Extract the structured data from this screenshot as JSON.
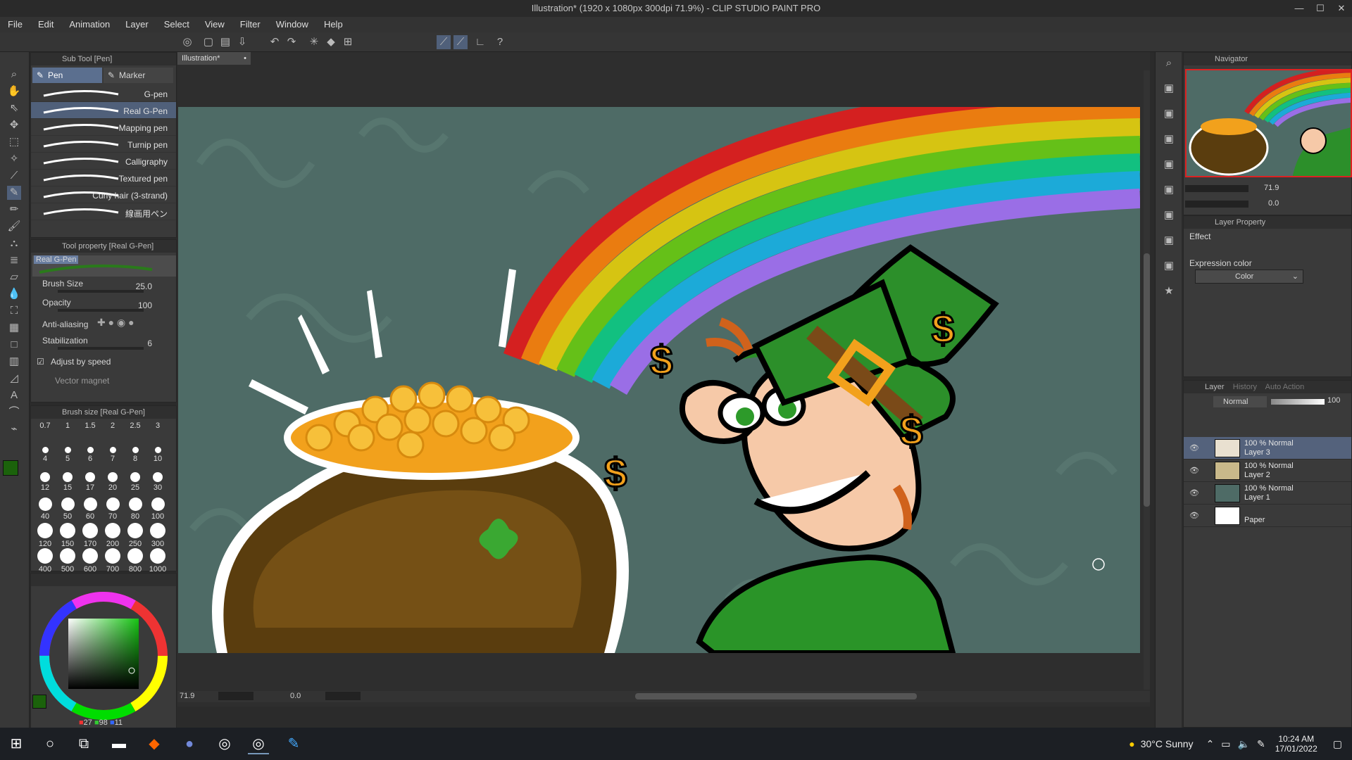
{
  "window": {
    "title": "Illustration* (1920 x 1080px 300dpi 71.9%) - CLIP STUDIO PAINT PRO",
    "controls": [
      "—",
      "☐",
      "✕"
    ]
  },
  "menu": [
    "File",
    "Edit",
    "Animation",
    "Layer",
    "Select",
    "View",
    "Filter",
    "Window",
    "Help"
  ],
  "subtool_panel": {
    "header": "Sub Tool [Pen]",
    "tabs": [
      "Pen",
      "Marker"
    ],
    "brushes": [
      "G-pen",
      "Real G-Pen",
      "Mapping pen",
      "Turnip pen",
      "Calligraphy",
      "Textured pen",
      "Curly hair (3-strand)",
      "線画用ペン"
    ],
    "selected_index": 1
  },
  "tool_property": {
    "header": "Tool property [Real G-Pen]",
    "preview_label": "Real G-Pen",
    "brush_size_label": "Brush Size",
    "brush_size_value": "25.0",
    "opacity_label": "Opacity",
    "opacity_value": "100",
    "antialias_label": "Anti-aliasing",
    "stabilization_label": "Stabilization",
    "stabilization_value": "6",
    "adjust_speed_label": "Adjust by speed",
    "vector_magnet_label": "Vector magnet"
  },
  "brush_size_panel": {
    "header": "Brush size [Real G-Pen]",
    "sizes": [
      "0.7",
      "1",
      "1.5",
      "2",
      "2.5",
      "3",
      "4",
      "5",
      "6",
      "7",
      "8",
      "10",
      "12",
      "15",
      "17",
      "20",
      "25",
      "30",
      "40",
      "50",
      "60",
      "70",
      "80",
      "100",
      "120",
      "150",
      "170",
      "200",
      "250",
      "300",
      "400",
      "500",
      "600",
      "700",
      "800",
      "1000"
    ]
  },
  "color": {
    "r": "27",
    "g": "98",
    "b": "11",
    "main_hex": "#1b620b",
    "sub_hex": "#ffffff"
  },
  "document": {
    "tab_label": "Illustration*",
    "zoom": "71.9",
    "rotation": "0.0"
  },
  "navigator": {
    "header": "Navigator",
    "zoom": "71.9",
    "rotation": "0.0"
  },
  "layer_property": {
    "header": "Layer Property",
    "effect_label": "Effect",
    "expression_label": "Expression color",
    "expression_value": "Color"
  },
  "layer_panel": {
    "tabs": [
      "Layer",
      "History",
      "Auto Action"
    ],
    "blend_mode": "Normal",
    "opacity": "100",
    "layers": [
      {
        "mode": "100 % Normal",
        "name": "Layer 3"
      },
      {
        "mode": "100 % Normal",
        "name": "Layer 2"
      },
      {
        "mode": "100 % Normal",
        "name": "Layer 1"
      },
      {
        "mode": "",
        "name": "Paper"
      }
    ]
  },
  "taskbar": {
    "weather_temp": "30°C",
    "weather_desc": "Sunny",
    "time": "10:24 AM",
    "date": "17/01/2022"
  },
  "canvas_art": {
    "dollar": "$"
  }
}
